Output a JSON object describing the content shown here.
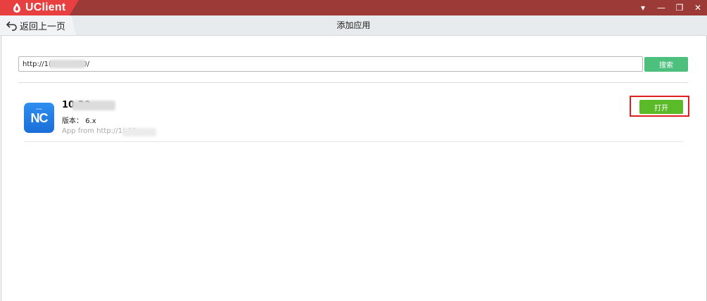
{
  "window": {
    "app_name": "UClient",
    "controls": {
      "menu": "▾",
      "minimize": "—",
      "restore": "❐",
      "close": "✕"
    }
  },
  "nav": {
    "back_label": "返回上一页",
    "page_title": "添加应用"
  },
  "search": {
    "url_value": "http://1(            80/",
    "button_label": "搜索"
  },
  "app": {
    "name": "10           30",
    "version_label": "版本：",
    "version_value": "6.x",
    "source": "App from http://1(             30",
    "icon_text": "NC",
    "icon_sub": "UFIDA",
    "open_label": "打开"
  },
  "colors": {
    "titlebar": "#9c3a38",
    "brand_tab": "#e84040",
    "search_button": "#4ec07e",
    "open_button": "#5bba28",
    "highlight": "#e02020",
    "app_icon": "#2f8ef0"
  }
}
